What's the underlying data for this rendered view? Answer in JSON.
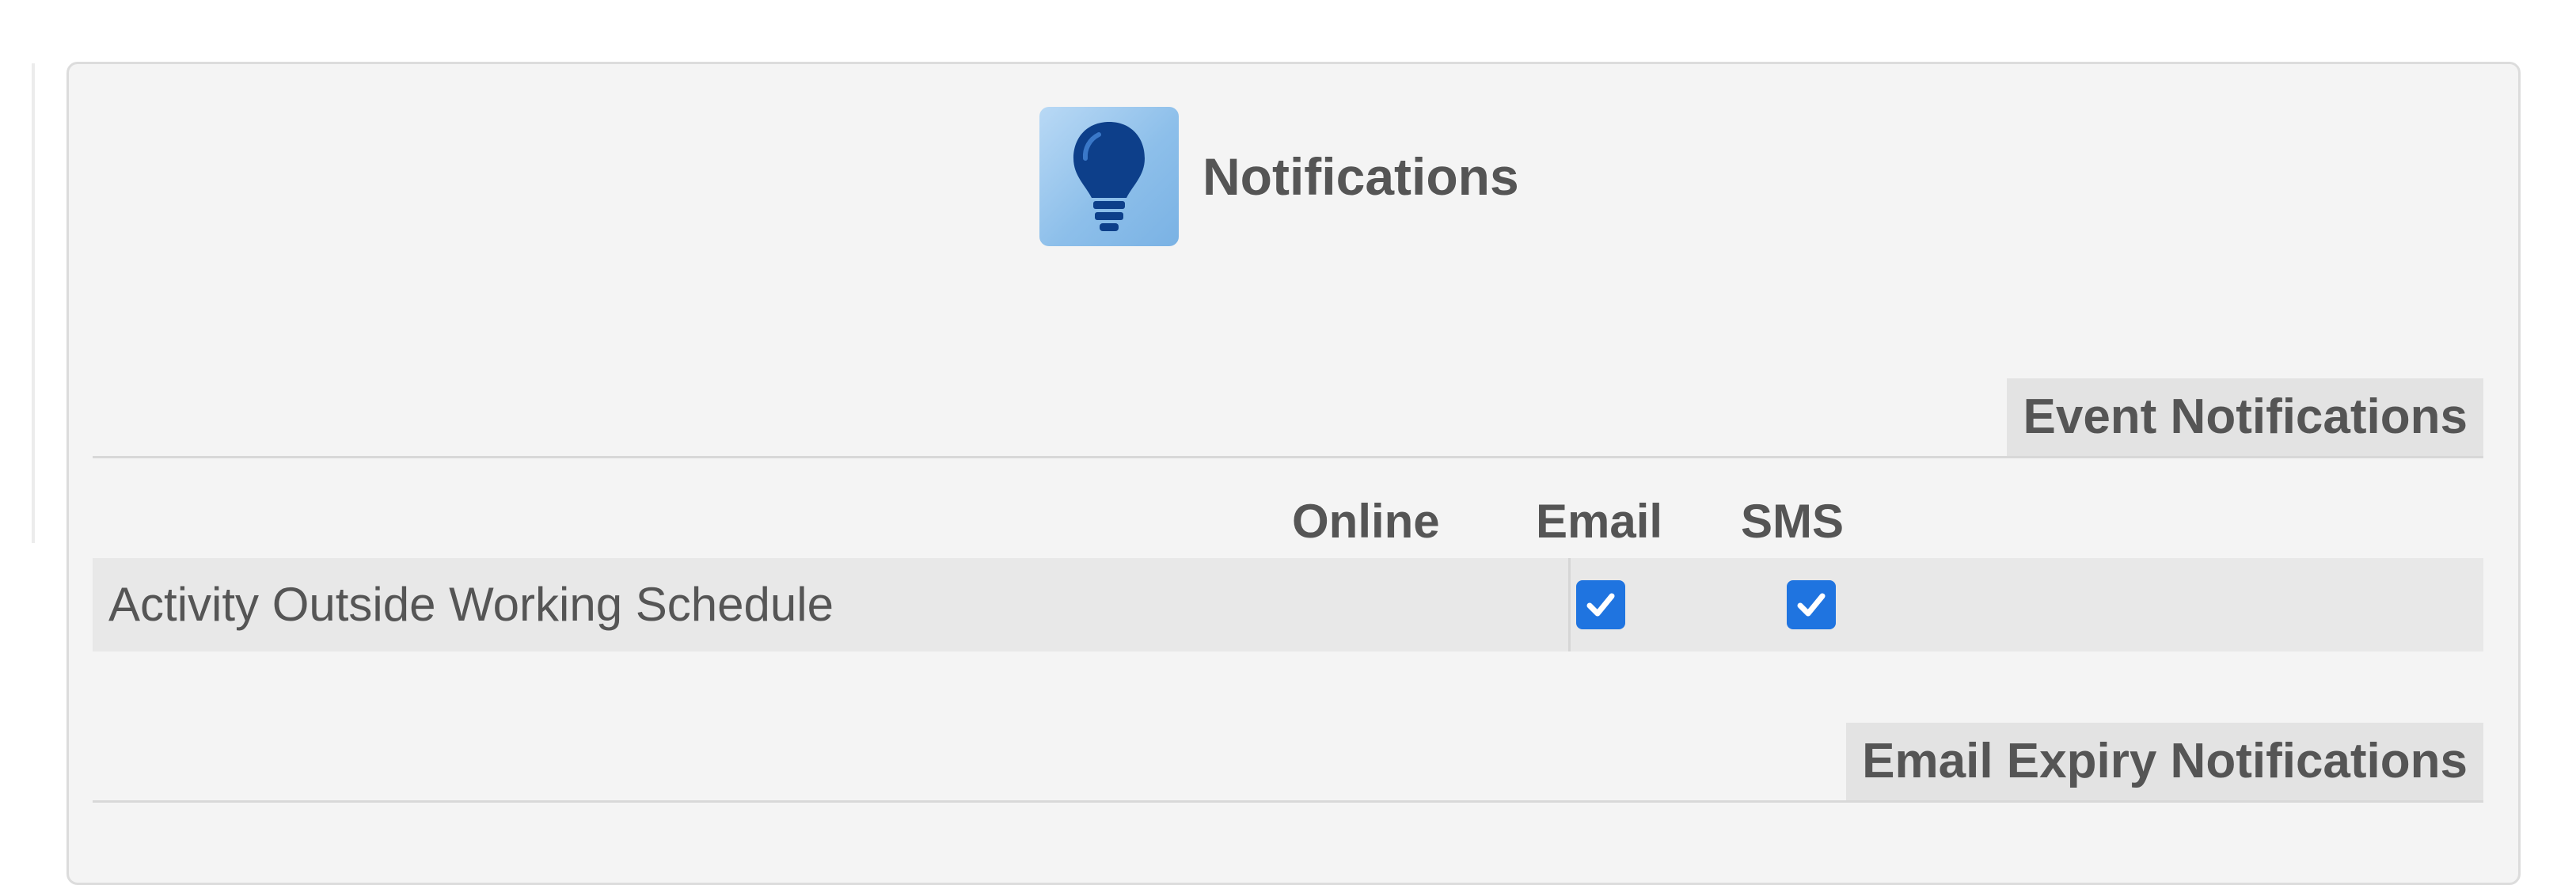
{
  "header": {
    "title": "Notifications",
    "icon": "lightbulb-icon"
  },
  "sections": [
    {
      "title": "Event Notifications",
      "columns": [
        "Online",
        "Email",
        "SMS"
      ],
      "rows": [
        {
          "label": "Activity Outside Working Schedule",
          "online": null,
          "email": true,
          "sms": true
        }
      ]
    },
    {
      "title": "Email Expiry Notifications"
    }
  ],
  "colors": {
    "checkbox": "#1f74e0",
    "icon_bg": "#8dbfea",
    "bulb": "#0d3f8a",
    "text": "#555555"
  }
}
